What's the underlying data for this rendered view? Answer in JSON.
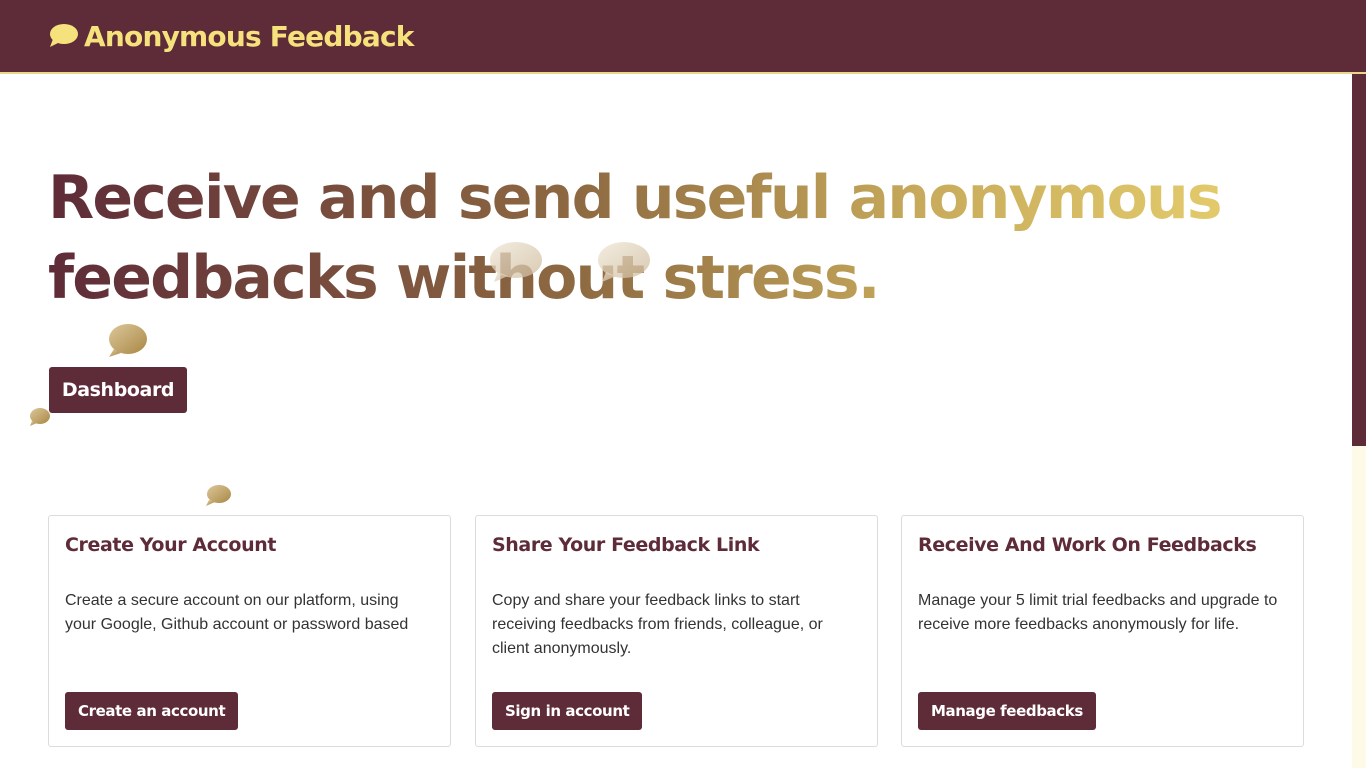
{
  "navbar": {
    "brand_icon": "speech-bubble-icon",
    "brand_text": "Anonymous Feedback"
  },
  "hero": {
    "title_line1": "Receive and send useful anonymous",
    "title_line2": "feedbacks without stress.",
    "dashboard_label": "Dashboard"
  },
  "cards": [
    {
      "title": "Create Your Account",
      "text": "Create a secure account on our platform, using your Google, Github account or password based",
      "button": "Create an account"
    },
    {
      "title": "Share Your Feedback Link",
      "text": "Copy and share your feedback links to start receiving feedbacks from friends, colleague, or client anonymously.",
      "button": "Sign in account"
    },
    {
      "title": "Receive And Work On Feedbacks",
      "text": "Manage your 5 limit trial feedbacks and upgrade to receive more feedbacks anonymously for life.",
      "button": "Manage feedbacks"
    }
  ],
  "colors": {
    "primary": "#5e2b38",
    "brand_yellow": "#f6e27c",
    "gradient_end": "#e3cb6c"
  }
}
